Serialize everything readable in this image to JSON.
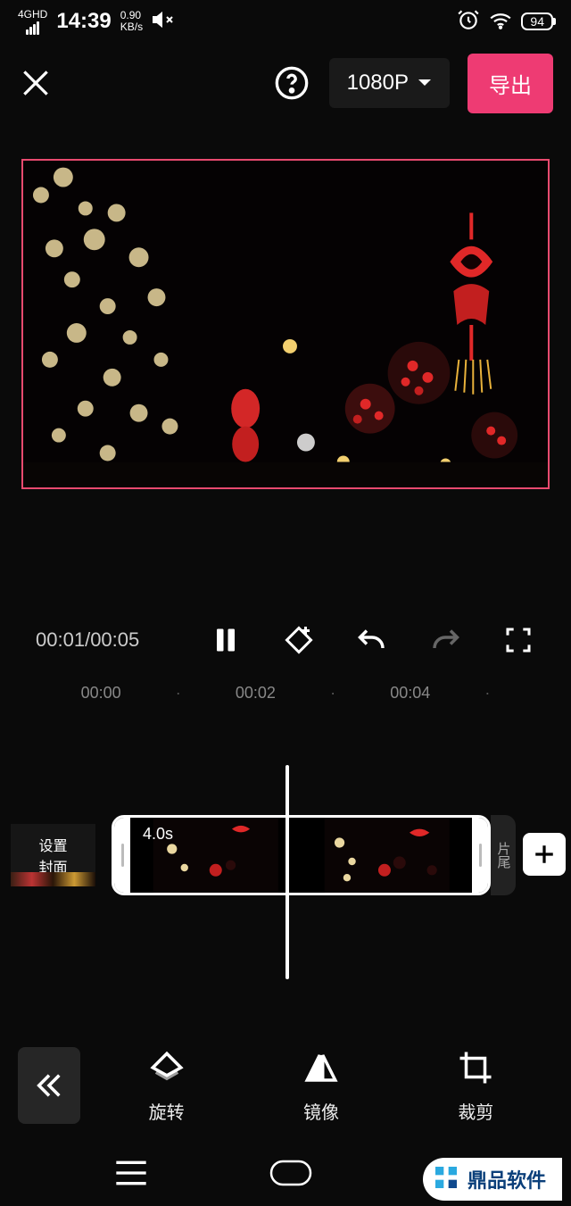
{
  "status": {
    "network_label": "4GHD",
    "time": "14:39",
    "speed_value": "0.90",
    "speed_unit": "KB/s",
    "battery": "94"
  },
  "toolbar": {
    "resolution": "1080P",
    "export": "导出"
  },
  "player": {
    "current_time": "00:01",
    "total_time": "00:05"
  },
  "ruler": {
    "marks": [
      "00:00",
      "·",
      "00:02",
      "·",
      "00:04",
      "·"
    ]
  },
  "timeline": {
    "cover_label_l1": "设置",
    "cover_label_l2": "封面",
    "clip_duration": "4.0s",
    "tail_label": "片尾"
  },
  "tools": {
    "rotate": "旋转",
    "mirror": "镜像",
    "crop": "裁剪"
  },
  "watermark": "鼎品软件",
  "chart_data": null
}
